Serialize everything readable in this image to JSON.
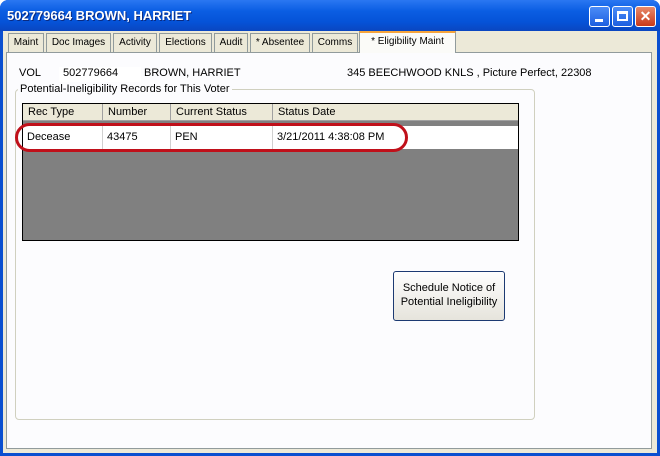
{
  "window": {
    "title": "502779664  BROWN, HARRIET",
    "buttons": {
      "minimize": "minimize-icon",
      "maximize": "maximize-icon",
      "close": "close-icon"
    }
  },
  "tabs": [
    {
      "label": "Maint"
    },
    {
      "label": "Doc Images"
    },
    {
      "label": "Activity"
    },
    {
      "label": "Elections"
    },
    {
      "label": "Audit"
    },
    {
      "label": "* Absentee"
    },
    {
      "label": "Comms"
    },
    {
      "label": "* Eligibility Maint",
      "active": true
    }
  ],
  "voter": {
    "status": "VOL",
    "id": "502779664",
    "name": "BROWN, HARRIET",
    "address": "345 BEECHWOOD KNLS , Picture Perfect, 22308"
  },
  "records": {
    "group_label": "Potential-Ineligibility Records for This Voter",
    "columns": [
      "Rec Type",
      "Number",
      "Current Status",
      "Status Date"
    ],
    "rows": [
      [
        "Decease",
        "43475",
        "PEN",
        "3/21/2011 4:38:08 PM"
      ]
    ]
  },
  "actions": {
    "schedule_line1": "Schedule Notice of",
    "schedule_line2": "Potential Ineligibility"
  },
  "colors": {
    "titlebar": "#0553d8",
    "highlight": "#c0101a",
    "active_tab_accent": "#f6a53c"
  }
}
